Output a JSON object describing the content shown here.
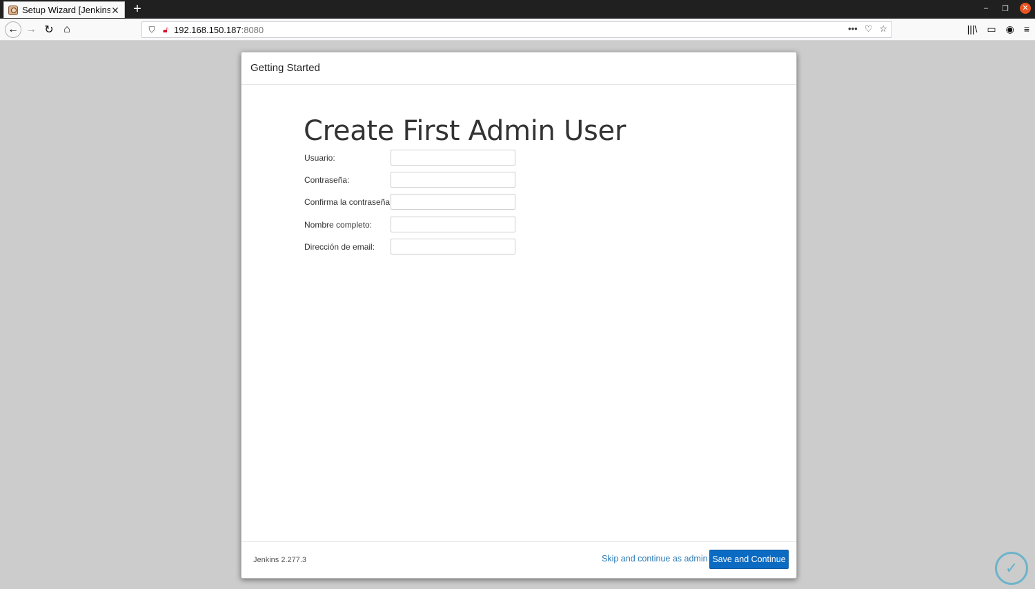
{
  "browser": {
    "tab_title": "Setup Wizard [Jenkins]",
    "url_host": "192.168.150.187",
    "url_port": ":8080"
  },
  "dialog": {
    "header": "Getting Started",
    "title": "Create First Admin User",
    "fields": [
      {
        "label": "Usuario:",
        "value": ""
      },
      {
        "label": "Contraseña:",
        "value": ""
      },
      {
        "label": "Confirma la contraseña:",
        "value": ""
      },
      {
        "label": "Nombre completo:",
        "value": ""
      },
      {
        "label": "Dirección de email:",
        "value": ""
      }
    ],
    "version": "Jenkins 2.277.3",
    "skip_label": "Skip and continue as admin",
    "save_label": "Save and Continue"
  },
  "colors": {
    "primary_button": "#0b6ac1",
    "link": "#2b7ab5",
    "page_background": "#cccccc"
  }
}
